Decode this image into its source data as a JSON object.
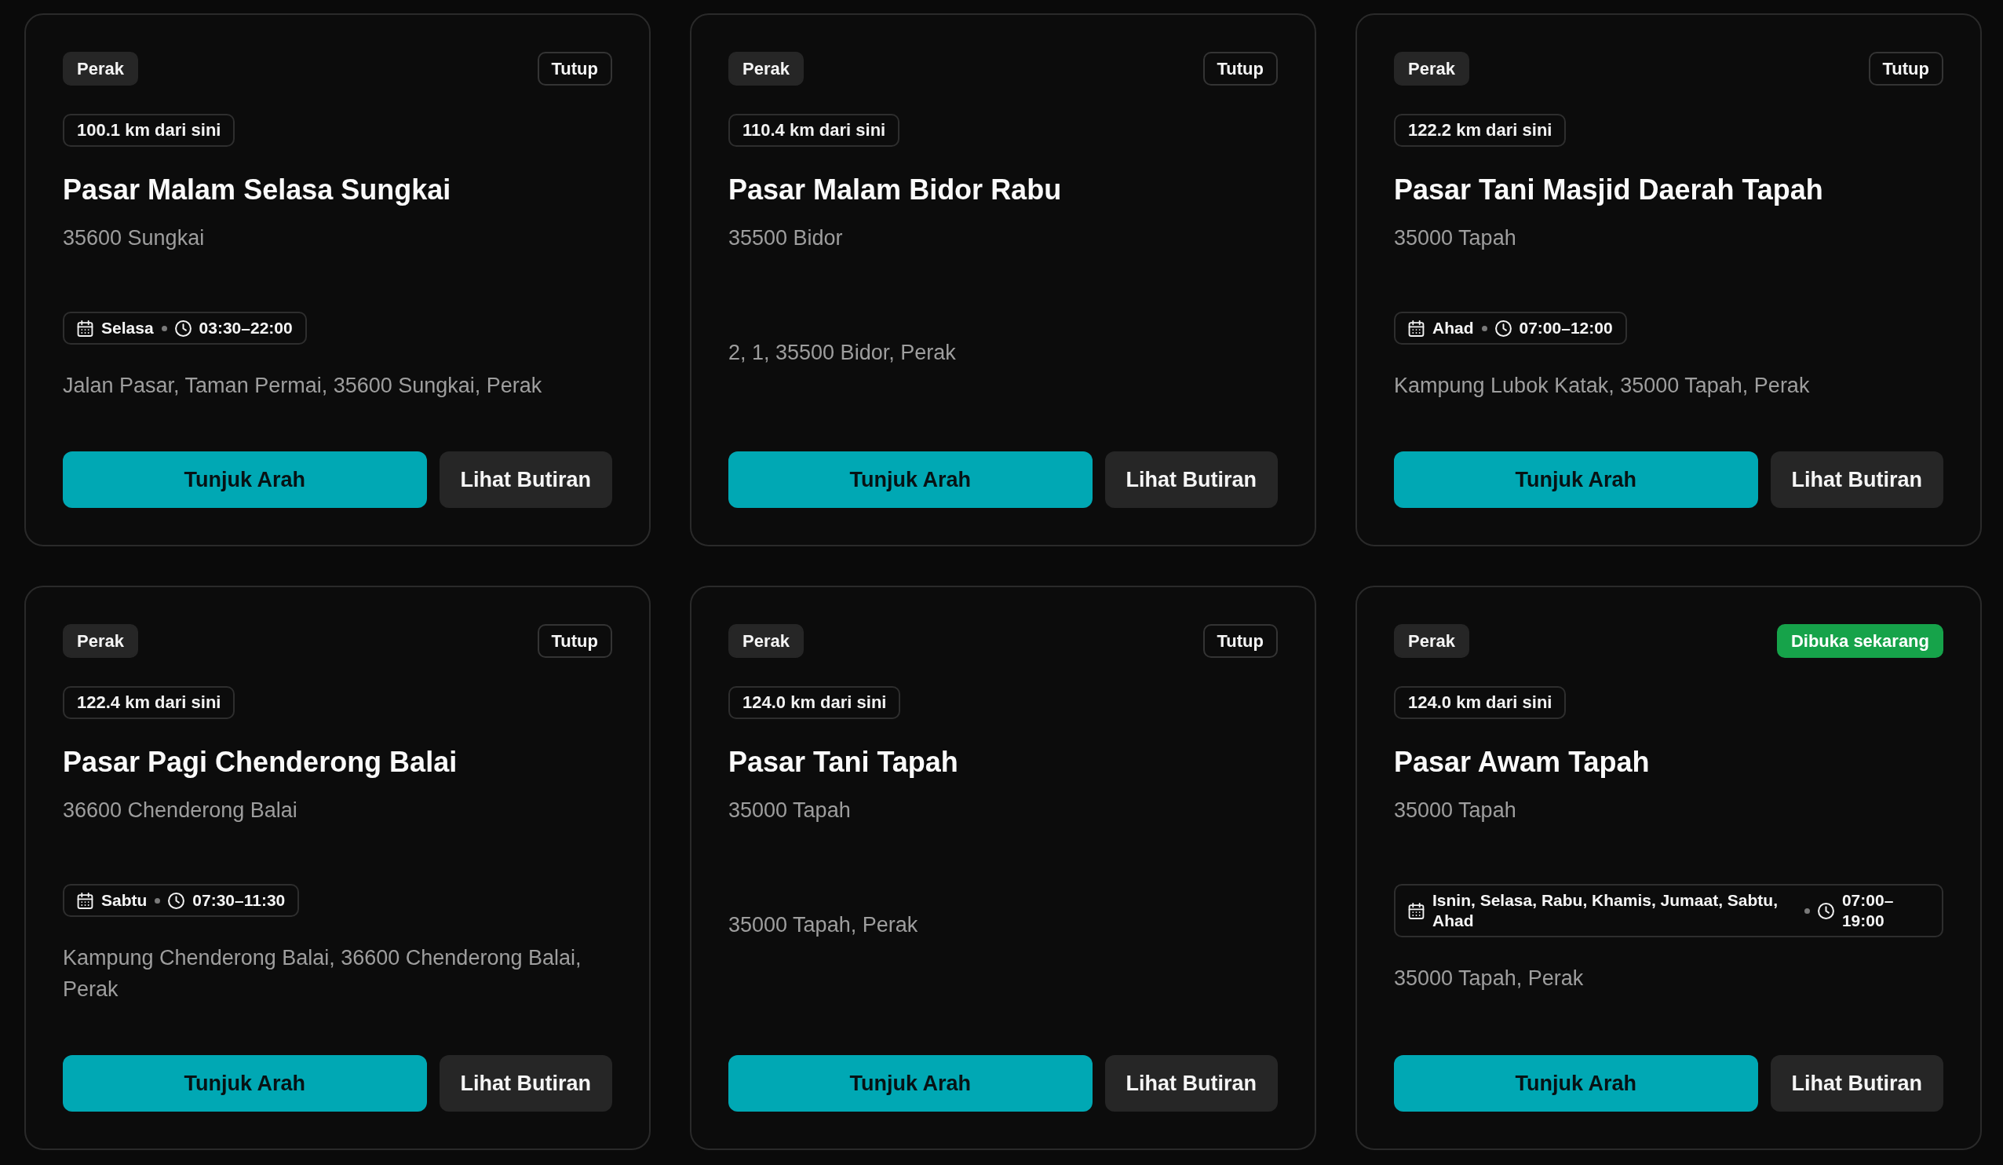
{
  "markets": [
    {
      "state": "Perak",
      "status": {
        "label": "Tutup",
        "open": false
      },
      "distance": "100.1 km dari sini",
      "name": "Pasar Malam Selasa Sungkai",
      "locality": "35600 Sungkai",
      "schedule": {
        "days": "Selasa",
        "hours": "03:30–22:00"
      },
      "address": "Jalan Pasar, Taman Permai, 35600 Sungkai, Perak",
      "actions": [
        {
          "kind": "primary",
          "label": "Tunjuk Arah"
        },
        {
          "kind": "secondary",
          "label": "Lihat Butiran"
        }
      ]
    },
    {
      "state": "Perak",
      "status": {
        "label": "Tutup",
        "open": false
      },
      "distance": "110.4 km dari sini",
      "name": "Pasar Malam Bidor Rabu",
      "locality": "35500 Bidor",
      "address": "2, 1, 35500 Bidor, Perak",
      "actions": [
        {
          "kind": "primary",
          "label": "Tunjuk Arah"
        },
        {
          "kind": "secondary",
          "label": "Lihat Butiran"
        }
      ]
    },
    {
      "state": "Perak",
      "status": {
        "label": "Tutup",
        "open": false
      },
      "distance": "122.2 km dari sini",
      "name": "Pasar Tani Masjid Daerah Tapah",
      "locality": "35000 Tapah",
      "schedule": {
        "days": "Ahad",
        "hours": "07:00–12:00"
      },
      "address": "Kampung Lubok Katak, 35000 Tapah, Perak",
      "actions": [
        {
          "kind": "primary",
          "label": "Tunjuk Arah"
        },
        {
          "kind": "secondary",
          "label": "Lihat Butiran"
        }
      ]
    },
    {
      "state": "Perak",
      "status": {
        "label": "Tutup",
        "open": false
      },
      "distance": "122.4 km dari sini",
      "name": "Pasar Pagi Chenderong Balai",
      "locality": "36600 Chenderong Balai",
      "schedule": {
        "days": "Sabtu",
        "hours": "07:30–11:30"
      },
      "address": "Kampung Chenderong Balai, 36600 Chenderong Balai, Perak",
      "actions": [
        {
          "kind": "primary",
          "label": "Tunjuk Arah"
        },
        {
          "kind": "secondary",
          "label": "Lihat Butiran"
        }
      ]
    },
    {
      "state": "Perak",
      "status": {
        "label": "Tutup",
        "open": false
      },
      "distance": "124.0 km dari sini",
      "name": "Pasar Tani Tapah",
      "locality": "35000 Tapah",
      "address": "35000 Tapah, Perak",
      "actions": [
        {
          "kind": "primary",
          "label": "Tunjuk Arah"
        },
        {
          "kind": "secondary",
          "label": "Lihat Butiran"
        }
      ]
    },
    {
      "state": "Perak",
      "status": {
        "label": "Dibuka sekarang",
        "open": true
      },
      "distance": "124.0 km dari sini",
      "name": "Pasar Awam Tapah",
      "locality": "35000 Tapah",
      "schedule": {
        "days": "Isnin, Selasa, Rabu, Khamis, Jumaat, Sabtu, Ahad",
        "hours": "07:00–19:00"
      },
      "address": "35000 Tapah, Perak",
      "actions": [
        {
          "kind": "primary",
          "label": "Tunjuk Arah"
        },
        {
          "kind": "secondary",
          "label": "Lihat Butiran"
        }
      ]
    }
  ]
}
